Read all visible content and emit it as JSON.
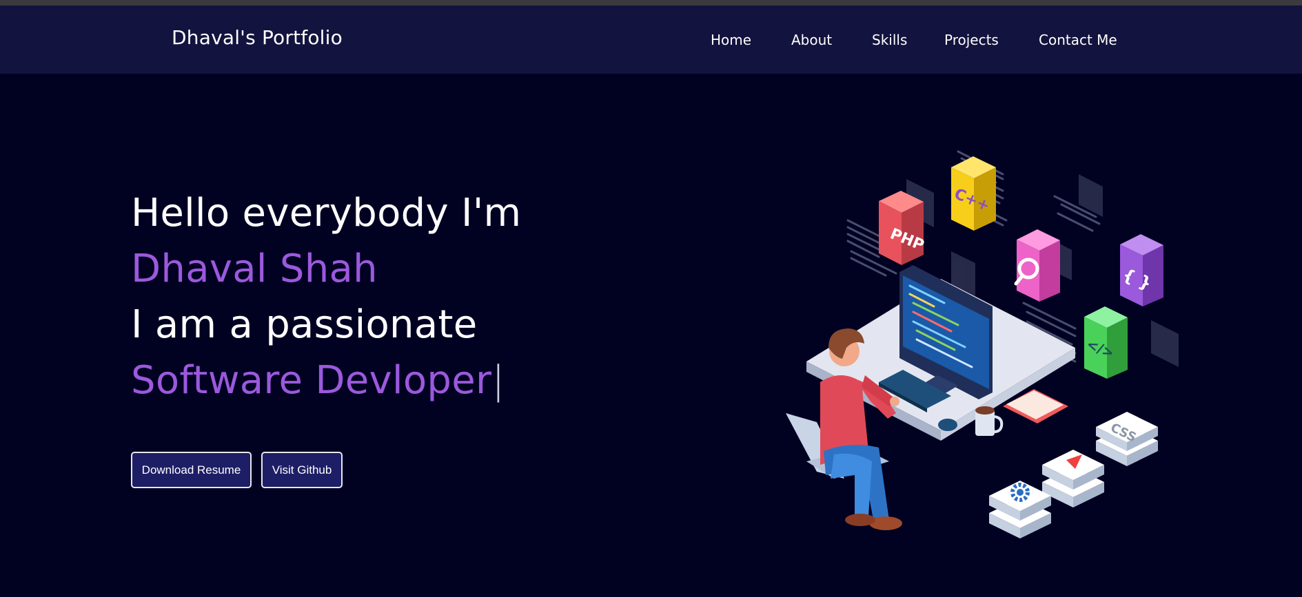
{
  "navbar": {
    "brand": "Dhaval's Portfolio",
    "links": [
      "Home",
      "About",
      "Skills",
      "Projects",
      "Contact Me"
    ]
  },
  "hero": {
    "line1": "Hello everybody I'm",
    "name": "Dhaval Shah",
    "line3": "I am a passionate",
    "role": "Software Devloper",
    "cursor": "|"
  },
  "buttons": {
    "resume": "Download Resume",
    "github": "Visit Github"
  },
  "illustration": {
    "badges": [
      "PHP",
      "C++",
      "{ }",
      "</>",
      "CSS"
    ]
  },
  "colors": {
    "background": "#010122",
    "navbar": "#13133f",
    "accent": "#9b59dc",
    "button": "#1e1e66"
  }
}
